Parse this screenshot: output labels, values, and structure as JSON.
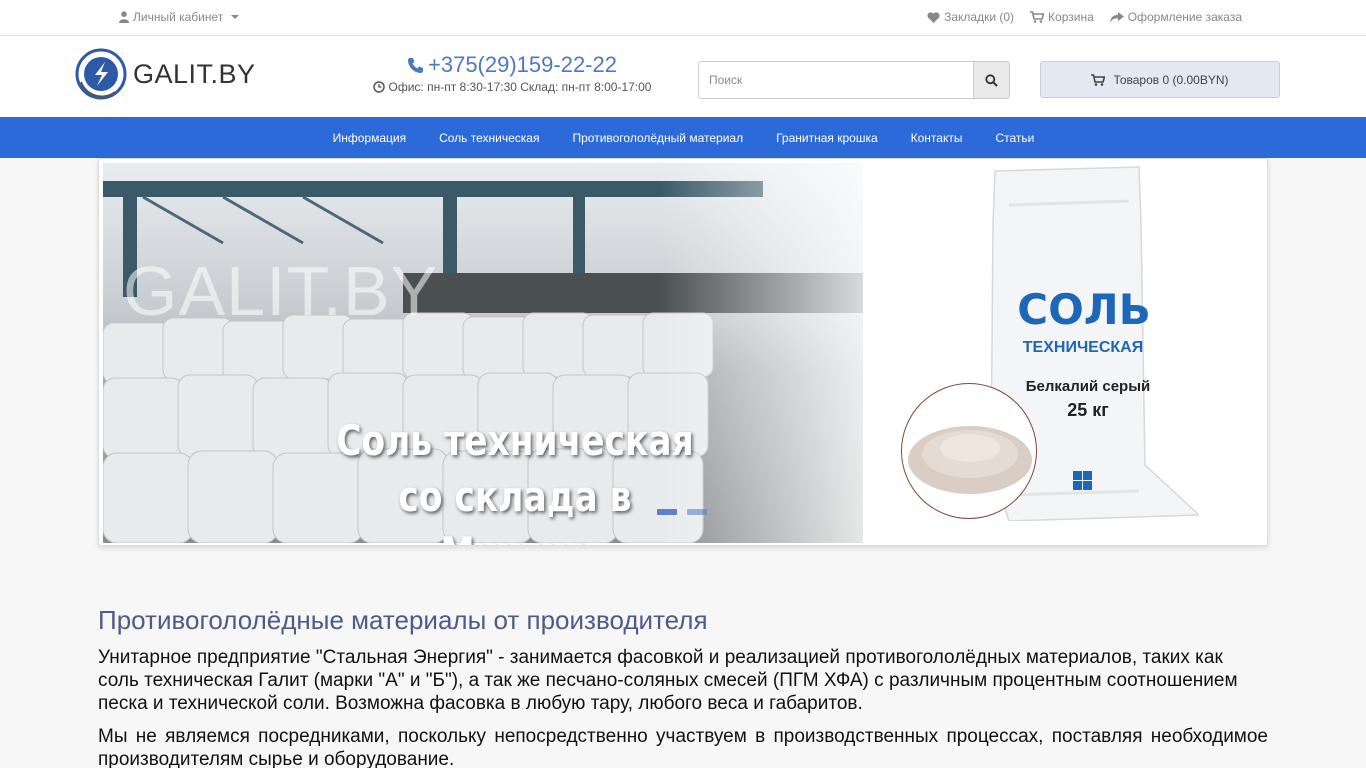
{
  "topbar": {
    "account": "Личный кабинет",
    "bookmarks": "Закладки (0)",
    "cart": "Корзина",
    "checkout": "Оформление заказа"
  },
  "header": {
    "logo_text": "GALIT.BY",
    "phone": "+375(29)159-22-22",
    "hours": "Офис: пн-пт 8:30-17:30 Склад: пн-пт 8:00-17:00",
    "search_placeholder": "Поиск",
    "cart_summary": "Товаров 0 (0.00BYN)"
  },
  "nav": {
    "items": [
      "Информация",
      "Соль техническая",
      "Противогололёдный материал",
      "Гранитная крошка",
      "Контакты",
      "Статьи"
    ]
  },
  "banner": {
    "watermark": "GALIT.BY",
    "slogan_line1": "Соль техническая",
    "slogan_line2": "со склада в Минске",
    "bag_title": "СОЛЬ",
    "bag_subtitle": "ТЕХНИЧЕСКАЯ",
    "bag_brand": "Белкалий серый",
    "bag_weight": "25 кг"
  },
  "content": {
    "heading": "Противогололёдные материалы от производителя",
    "paragraph1": "Унитарное предприятие \"Стальная Энергия\" - занимается фасовкой и реализацией противогололёдных материалов, таких как соль техническая Галит (марки \"А\" и \"Б\"), а так же песчано-соляных смесей (ПГМ ХФА) с различным процентным соотношением песка и технической соли. Возможна фасовка в любую тару, любого веса и габаритов.",
    "paragraph2": "Мы не являемся посредниками, поскольку непосредственно участвуем в производственных процессах, поставляя необходимое производителям сырье и оборудование."
  },
  "colors": {
    "nav_bg": "#2d6ad9",
    "link_blue": "#4d78c6",
    "heading": "#4f5a8a"
  }
}
